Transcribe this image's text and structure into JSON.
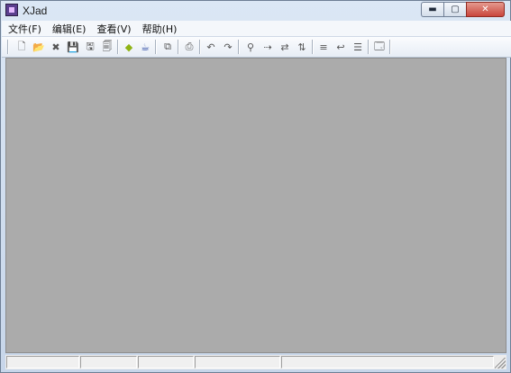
{
  "window": {
    "title": "XJad"
  },
  "caption": {
    "minimize": "▬",
    "maximize": "▢",
    "close": "✕"
  },
  "menubar": {
    "items": [
      {
        "label": "文件(F)"
      },
      {
        "label": "编辑(E)"
      },
      {
        "label": "查看(V)"
      },
      {
        "label": "帮助(H)"
      }
    ]
  },
  "toolbar": {
    "icons": [
      {
        "name": "new-file-icon",
        "glyph": "🗋"
      },
      {
        "name": "open-folder-icon",
        "glyph": "📂"
      },
      {
        "name": "close-file-icon",
        "glyph": "✖"
      },
      {
        "name": "save-icon",
        "glyph": "💾"
      },
      {
        "name": "save-as-icon",
        "glyph": "🖫"
      },
      {
        "name": "save-all-icon",
        "glyph": "🗐"
      },
      {
        "name": "decompile-icon",
        "glyph": "◆"
      },
      {
        "name": "java-icon",
        "glyph": "☕"
      },
      {
        "name": "copy-icon",
        "glyph": "⧉"
      },
      {
        "name": "print-icon",
        "glyph": "⎙"
      },
      {
        "name": "undo-icon",
        "glyph": "↶"
      },
      {
        "name": "redo-icon",
        "glyph": "↷"
      },
      {
        "name": "find-icon",
        "glyph": "⚲"
      },
      {
        "name": "find-next-icon",
        "glyph": "⇢"
      },
      {
        "name": "replace-icon",
        "glyph": "⇄"
      },
      {
        "name": "sort-icon",
        "glyph": "⇅"
      },
      {
        "name": "align-left-icon",
        "glyph": "≡"
      },
      {
        "name": "word-wrap-icon",
        "glyph": "↩"
      },
      {
        "name": "line-numbers-icon",
        "glyph": "☰"
      },
      {
        "name": "properties-icon",
        "glyph": "🗔"
      }
    ]
  },
  "colors": {
    "client_background": "#ababab",
    "window_frame": "#d7e4f2",
    "close_button": "#c9453c"
  }
}
